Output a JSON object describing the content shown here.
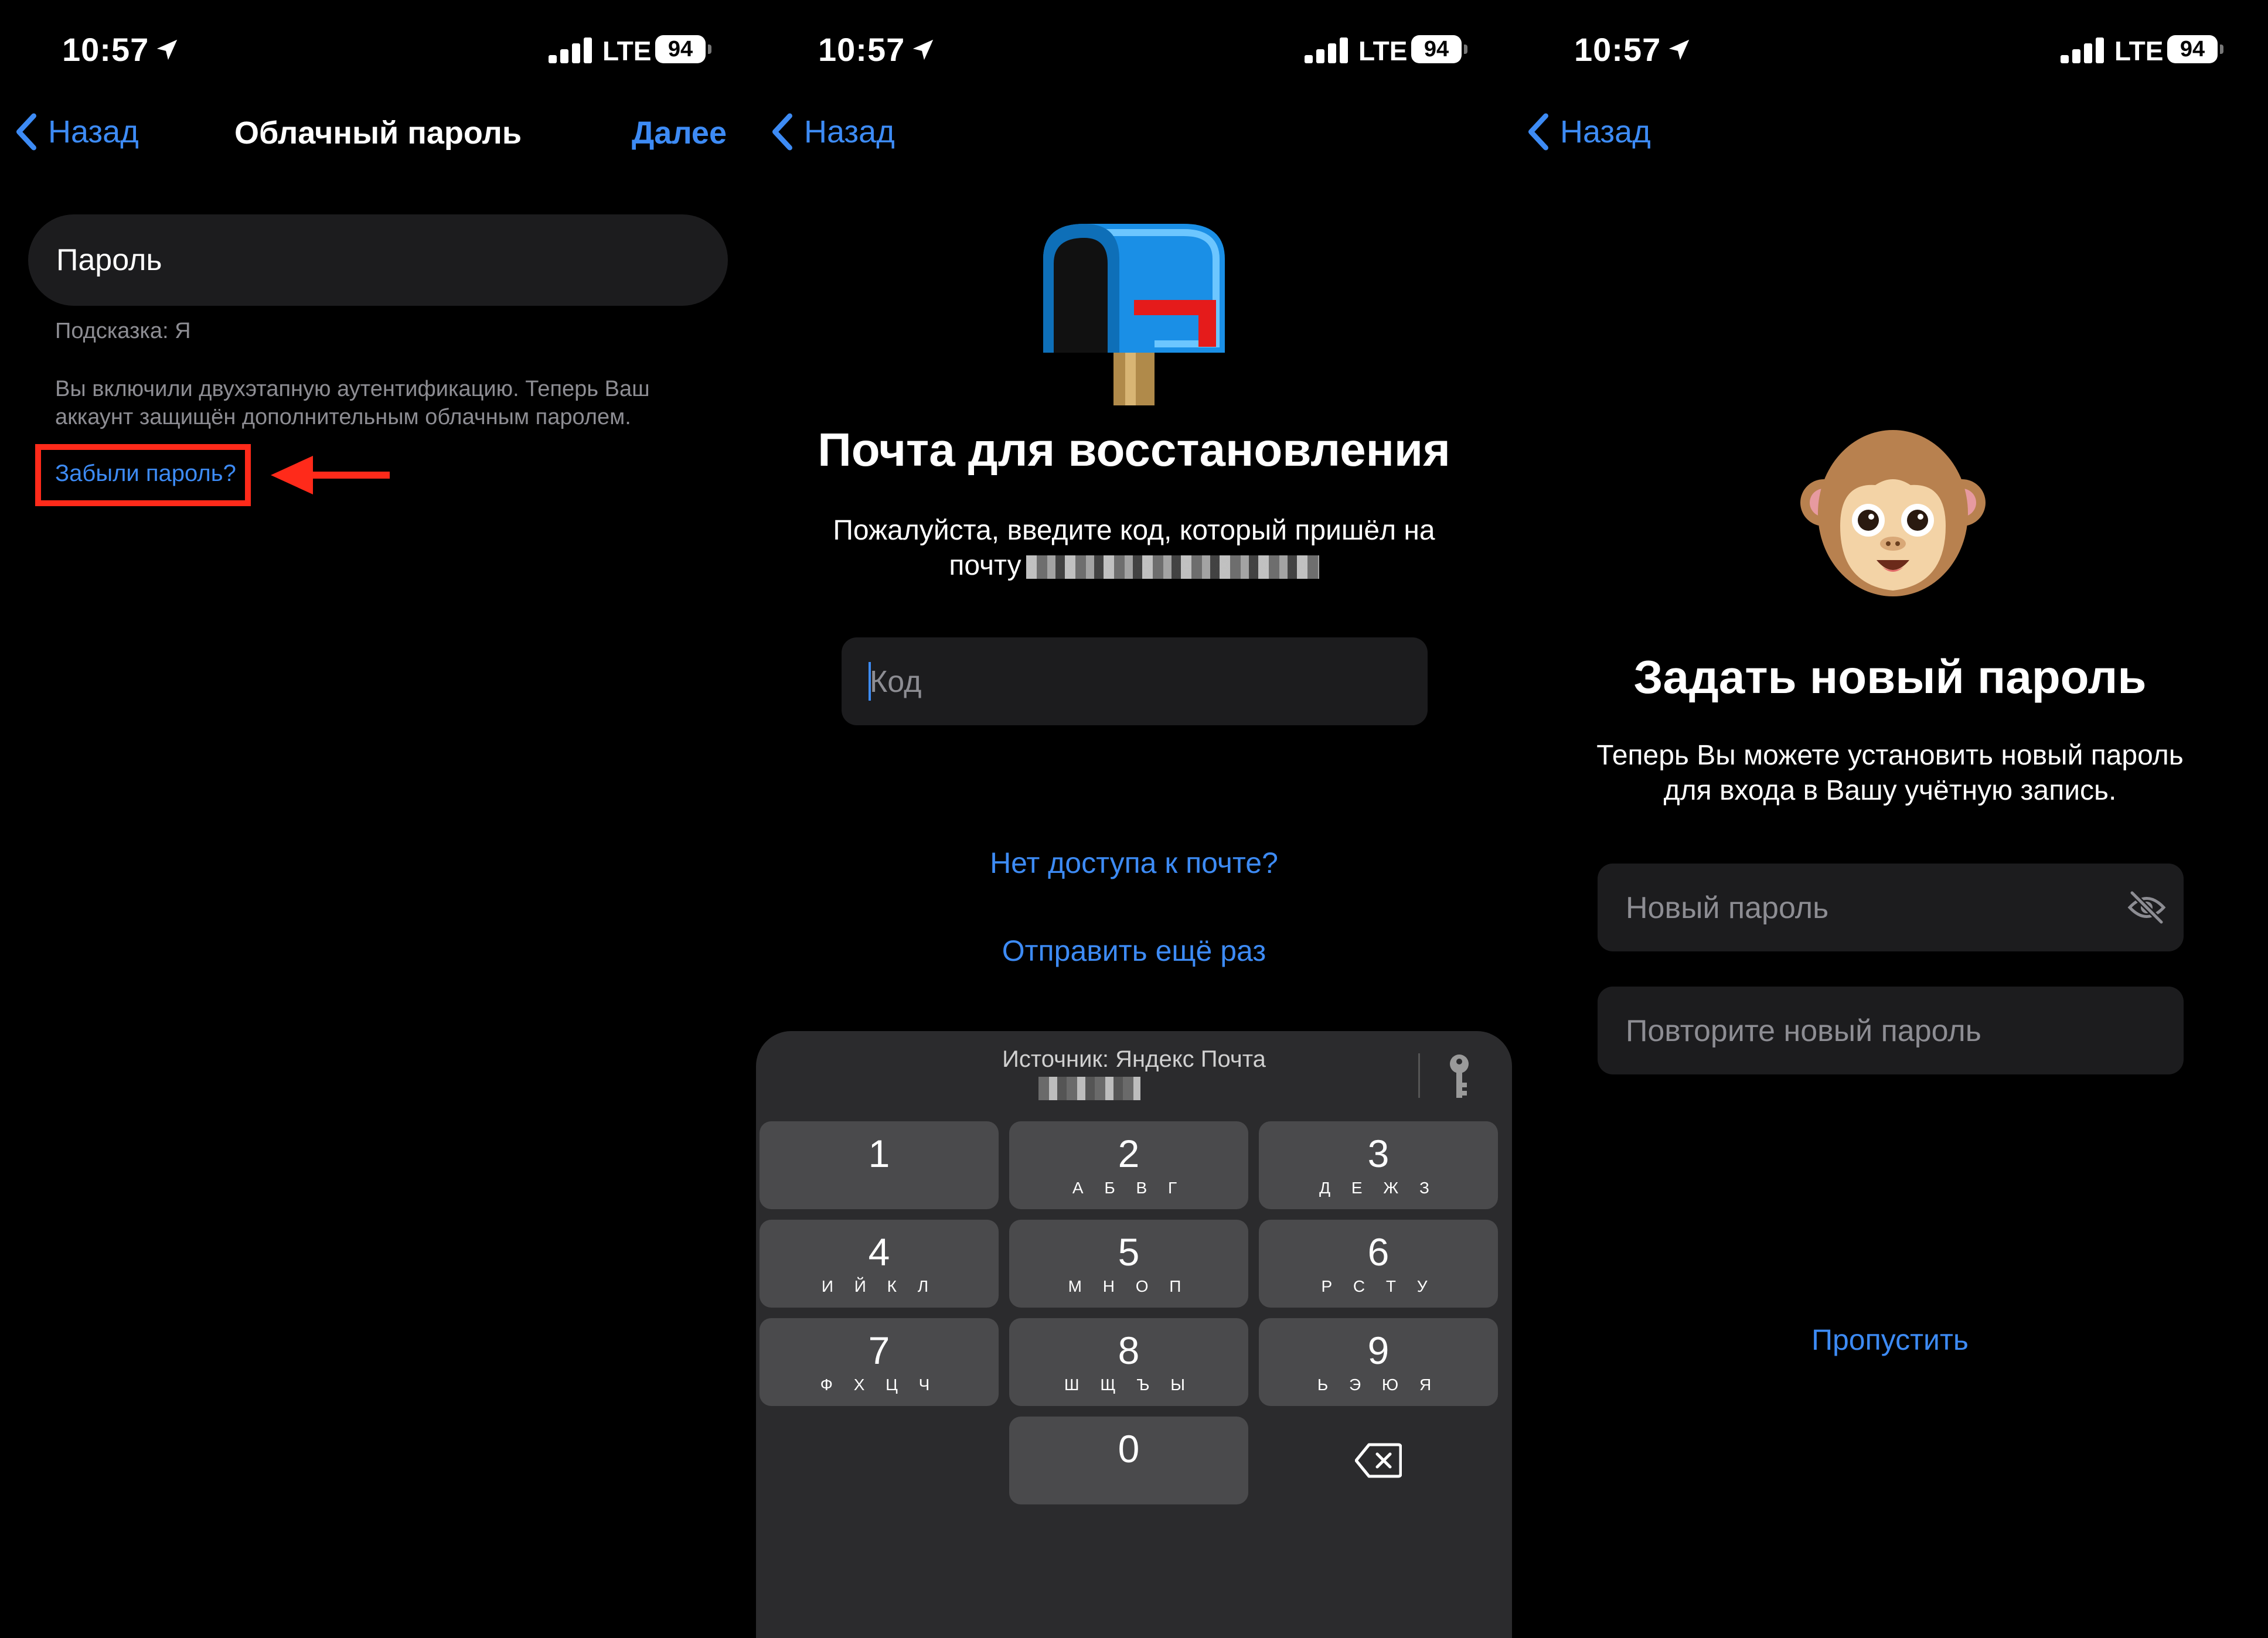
{
  "status_bar": {
    "time": "10:57",
    "network": "LTE",
    "battery": "94"
  },
  "screen1": {
    "back_label": "Назад",
    "title": "Облачный пароль",
    "next_label": "Далее",
    "password_placeholder": "Пароль",
    "hint": "Подсказка: Я",
    "description": "Вы включили двухэтапную аутентификацию. Теперь Ваш аккаунт защищён дополнительным облачным паролем.",
    "forgot_link": "Забыли пароль?"
  },
  "screen2": {
    "back_label": "Назад",
    "title": "Почта для восстановления",
    "instructions_line1": "Пожалуйста, введите код, который пришёл на",
    "instructions_line2": "почту",
    "code_placeholder": "Код",
    "no_access_link": "Нет доступа к почте?",
    "resend_link": "Отправить ещё раз",
    "keyboard": {
      "source_label": "Источник: Яндекс Почта",
      "keys": [
        {
          "digit": "1",
          "letters": ""
        },
        {
          "digit": "2",
          "letters": "А Б В Г"
        },
        {
          "digit": "3",
          "letters": "Д Е Ж З"
        },
        {
          "digit": "4",
          "letters": "И Й К Л"
        },
        {
          "digit": "5",
          "letters": "М Н О П"
        },
        {
          "digit": "6",
          "letters": "Р С Т У"
        },
        {
          "digit": "7",
          "letters": "Ф Х Ц Ч"
        },
        {
          "digit": "8",
          "letters": "Ш Щ Ъ Ы"
        },
        {
          "digit": "9",
          "letters": "Ь Э Ю Я"
        },
        {
          "digit": "0",
          "letters": ""
        }
      ]
    }
  },
  "screen3": {
    "back_label": "Назад",
    "title": "Задать новый пароль",
    "description_line1": "Теперь Вы можете установить новый пароль",
    "description_line2": "для входа в Вашу учётную запись.",
    "new_password_placeholder": "Новый пароль",
    "repeat_password_placeholder": "Повторите новый пароль",
    "skip_link": "Пропустить"
  },
  "colors": {
    "accent": "#3d8bf5",
    "highlight": "#ff2a1a",
    "field": "#1c1c1e",
    "secondary_text": "#8d8d93"
  }
}
